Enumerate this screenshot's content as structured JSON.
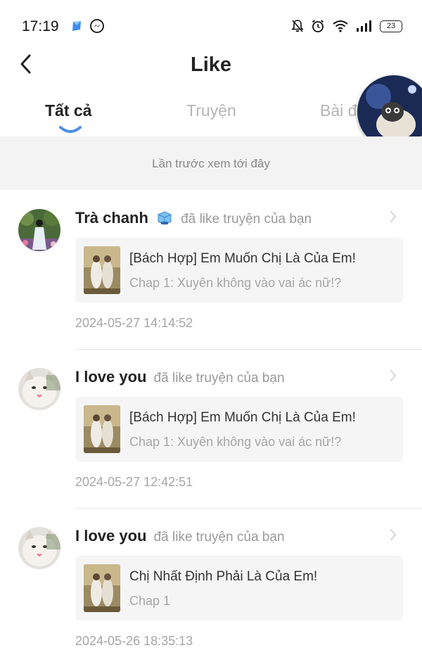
{
  "status_bar": {
    "time": "17:19",
    "battery": "23",
    "icons": [
      "app-icon",
      "messenger-icon",
      "bell-muted-icon",
      "alarm-icon",
      "wifi-icon",
      "signal-icon",
      "battery-icon"
    ]
  },
  "header": {
    "title": "Like",
    "back_icon": "back-chevron-icon"
  },
  "tabs": [
    {
      "label": "Tất cả",
      "active": true
    },
    {
      "label": "Truyện",
      "active": false
    },
    {
      "label": "Bài đ",
      "active": false
    }
  ],
  "divider_note": "Lần trước xem tới đây",
  "notifications": [
    {
      "user": "Trà chanh",
      "badge_icon": "ice-cube-icon",
      "action": "đã like truyện của bạn",
      "story_title": "[Bách Hợp] Em Muốn Chị Là Của Em!",
      "chapter": "Chap 1: Xuyên không vào vai ác nữ!?",
      "timestamp": "2024-05-27 14:14:52"
    },
    {
      "user": "I love you",
      "action": "đã like truyện của bạn",
      "story_title": "[Bách Hợp] Em Muốn Chị Là Của Em!",
      "chapter": "Chap 1: Xuyên không vào vai ác nữ!?",
      "timestamp": "2024-05-27 12:42:51"
    },
    {
      "user": "I love you",
      "action": "đã like truyện của bạn",
      "story_title": "Chị Nhất Định Phải Là Của Em!",
      "chapter": "Chap 1",
      "timestamp": "2024-05-26 18:35:13"
    }
  ],
  "colors": {
    "accent": "#4a90e2",
    "text_primary": "#222222",
    "text_secondary": "#a6a6a6",
    "card_bg": "#f5f5f5",
    "note_bg": "#f3f3f3"
  }
}
